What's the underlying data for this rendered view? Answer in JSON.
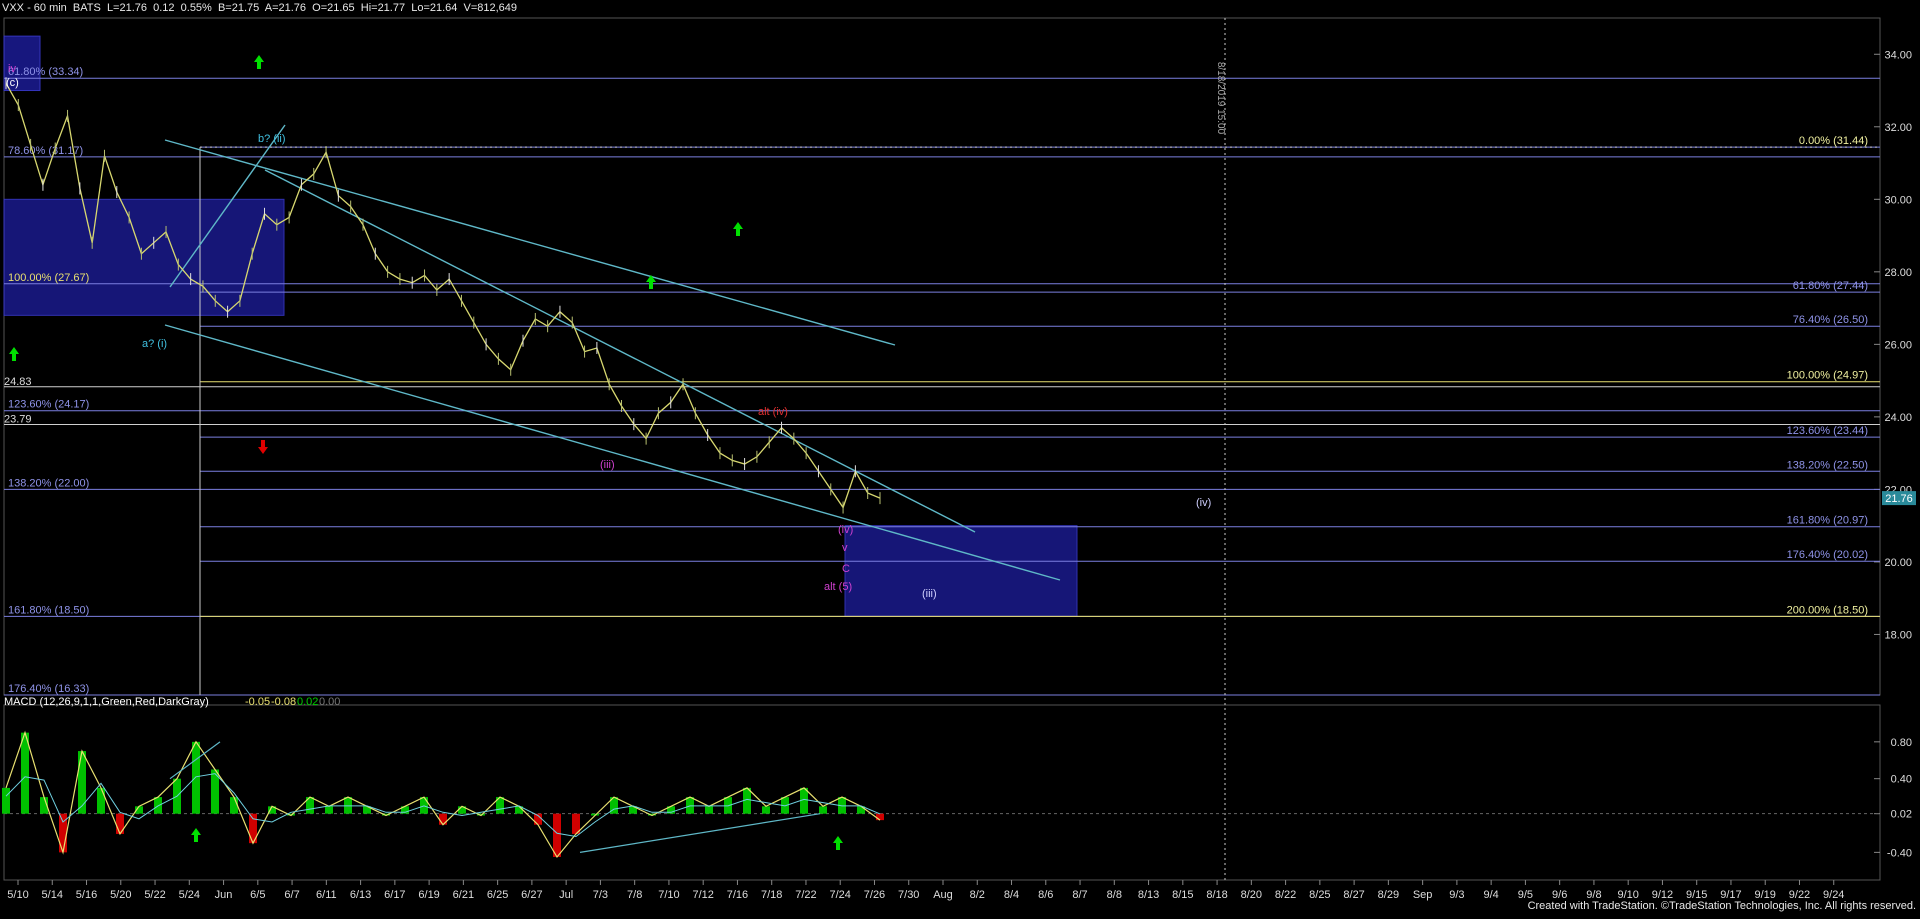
{
  "header": {
    "symbol_line": "VXX - 60 min  BATS  L=21.76  0.12  0.55%  B=21.75  A=21.76  O=21.65  Hi=21.77  Lo=21.64  V=812,649"
  },
  "macd": {
    "label": "MACD (12,26,9,1,1,Green,Red,DarkGray)",
    "v1": "-0.05",
    "v2": "-0.08",
    "v3": "0.02",
    "v4": "0.00"
  },
  "footer": {
    "credit": "Created with TradeStation. ©TradeStation Technologies, Inc. All rights reserved."
  },
  "colors": {
    "background": "#000000",
    "grid": "#3a3a3a",
    "fib_line_blue": "#7b7fe0",
    "fib_line_yellow": "#e8e070",
    "channel": "#5fb8c8",
    "zone": "#1a1a8c",
    "price_bar": "#d8d870",
    "up_arrow": "#00e000",
    "down_arrow": "#e00000",
    "wave_magenta": "#d040d0",
    "wave_cyan": "#40c0e0",
    "wave_red": "#e03030",
    "last_price_tag": "#2a8a9a"
  },
  "chart_data": [
    {
      "type": "line",
      "title": "VXX - 60 min",
      "xlabel": "",
      "ylabel": "",
      "ylim": [
        16.33,
        35.0
      ],
      "y_ticks": [
        "34.00",
        "32.00",
        "30.00",
        "28.00",
        "26.00",
        "24.00",
        "22.00",
        "20.00",
        "18.00"
      ],
      "x_ticks": [
        "5/10",
        "5/14",
        "5/16",
        "5/20",
        "5/22",
        "5/24",
        "Jun",
        "6/5",
        "6/7",
        "6/11",
        "6/13",
        "6/17",
        "6/19",
        "6/21",
        "6/25",
        "6/27",
        "Jul",
        "7/3",
        "7/8",
        "7/10",
        "7/12",
        "7/16",
        "7/18",
        "7/22",
        "7/24",
        "7/26",
        "7/30",
        "Aug",
        "8/2",
        "8/4",
        "8/6",
        "8/7",
        "8/8",
        "8/13",
        "8/15",
        "8/18",
        "8/20",
        "8/22",
        "8/25",
        "8/27",
        "8/29",
        "Sep",
        "9/3",
        "9/4",
        "9/5",
        "9/6",
        "9/8",
        "9/10",
        "9/12",
        "9/15",
        "9/17",
        "9/19",
        "9/22",
        "9/24"
      ],
      "last_price": "21.76",
      "series": [
        {
          "name": "VXX",
          "values": [
            33.2,
            32.6,
            31.5,
            30.4,
            31.4,
            32.3,
            30.3,
            28.8,
            31.2,
            30.2,
            29.5,
            28.5,
            28.8,
            29.1,
            28.2,
            27.8,
            27.6,
            27.2,
            26.9,
            27.2,
            28.5,
            29.6,
            29.3,
            29.5,
            30.4,
            30.7,
            31.3,
            30.1,
            29.8,
            29.3,
            28.5,
            28.0,
            27.8,
            27.7,
            27.9,
            27.5,
            27.8,
            27.2,
            26.6,
            26.0,
            25.6,
            25.3,
            26.1,
            26.7,
            26.5,
            26.9,
            26.6,
            25.8,
            25.9,
            24.9,
            24.3,
            23.8,
            23.4,
            24.1,
            24.4,
            24.9,
            24.1,
            23.5,
            23.0,
            22.8,
            22.7,
            22.9,
            23.3,
            23.7,
            23.4,
            23.0,
            22.5,
            22.0,
            21.5,
            22.5,
            21.9,
            21.76
          ]
        }
      ],
      "fib_levels_left": [
        {
          "label": "61.80% (33.34)",
          "value": 33.34
        },
        {
          "label": "78.60% (31.17)",
          "value": 31.17
        },
        {
          "label": "100.00% (27.67)",
          "value": 27.67
        },
        {
          "label": "123.60% (24.17)",
          "value": 24.17
        },
        {
          "label": "138.20% (22.00)",
          "value": 22.0
        },
        {
          "label": "161.80% (18.50)",
          "value": 18.5
        },
        {
          "label": "176.40% (16.33)",
          "value": 16.33
        }
      ],
      "fib_levels_right": [
        {
          "label": "0.00% (31.44)",
          "value": 31.44
        },
        {
          "label": "61.80% (27.44)",
          "value": 27.44
        },
        {
          "label": "76.40% (26.50)",
          "value": 26.5
        },
        {
          "label": "100.00% (24.97)",
          "value": 24.97
        },
        {
          "label": "123.60% (23.44)",
          "value": 23.44
        },
        {
          "label": "138.20% (22.50)",
          "value": 22.5
        },
        {
          "label": "161.80% (20.97)",
          "value": 20.97
        },
        {
          "label": "176.40% (20.02)",
          "value": 20.02
        },
        {
          "label": "200.00% (18.50)",
          "value": 18.5
        }
      ],
      "level_labels": [
        {
          "label": "24.83",
          "value": 24.83
        },
        {
          "label": "23.79",
          "value": 23.79
        }
      ],
      "wave_labels": [
        "iv",
        "(c)",
        "b? (ii)",
        "a? (i)",
        "(iii)",
        "alt (iv)",
        "(iv)",
        "v",
        "C",
        "alt (5)",
        "(iii)",
        "(iv)"
      ],
      "vertical_marker_label": "8/18/2019 15:00"
    },
    {
      "type": "line",
      "title": "MACD (12,26,9,1,1,Green,Red,DarkGray)",
      "ylim": [
        -0.7,
        1.2
      ],
      "y_ticks": [
        "0.80",
        "0.40",
        "0.02",
        "-0.40"
      ],
      "series": [
        {
          "name": "MACD",
          "values": [
            0.3,
            0.9,
            0.2,
            -0.4,
            0.7,
            0.3,
            -0.2,
            0.1,
            0.2,
            0.4,
            0.8,
            0.5,
            0.2,
            -0.3,
            0.1,
            0.0,
            0.2,
            0.1,
            0.2,
            0.1,
            0.0,
            0.1,
            0.2,
            -0.1,
            0.1,
            0.0,
            0.2,
            0.1,
            -0.1,
            -0.45,
            -0.2,
            0.0,
            0.2,
            0.1,
            0.0,
            0.1,
            0.2,
            0.1,
            0.2,
            0.3,
            0.1,
            0.2,
            0.3,
            0.1,
            0.2,
            0.1,
            -0.05
          ]
        }
      ]
    }
  ]
}
